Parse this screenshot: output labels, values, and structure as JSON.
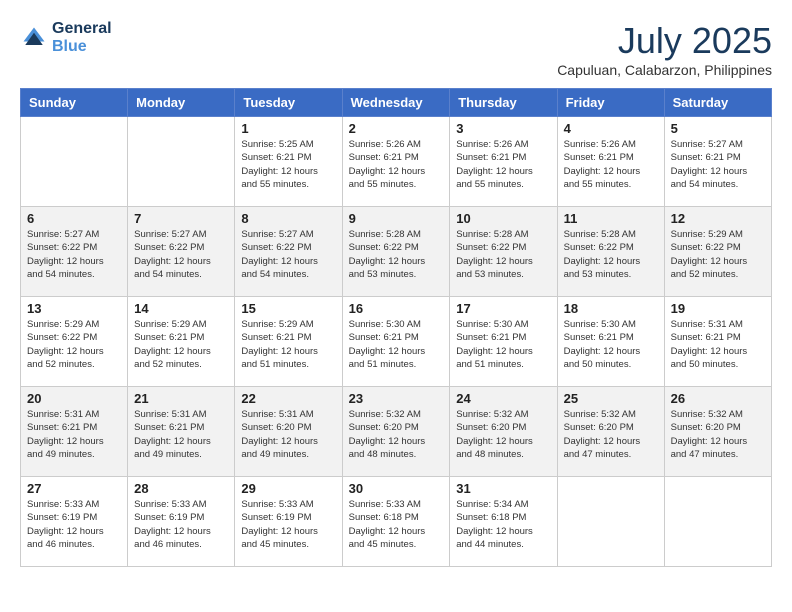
{
  "header": {
    "logo_line1": "General",
    "logo_line2": "Blue",
    "month_title": "July 2025",
    "subtitle": "Capuluan, Calabarzon, Philippines"
  },
  "weekdays": [
    "Sunday",
    "Monday",
    "Tuesday",
    "Wednesday",
    "Thursday",
    "Friday",
    "Saturday"
  ],
  "weeks": [
    [
      {
        "day": "",
        "info": ""
      },
      {
        "day": "",
        "info": ""
      },
      {
        "day": "1",
        "info": "Sunrise: 5:25 AM\nSunset: 6:21 PM\nDaylight: 12 hours and 55 minutes."
      },
      {
        "day": "2",
        "info": "Sunrise: 5:26 AM\nSunset: 6:21 PM\nDaylight: 12 hours and 55 minutes."
      },
      {
        "day": "3",
        "info": "Sunrise: 5:26 AM\nSunset: 6:21 PM\nDaylight: 12 hours and 55 minutes."
      },
      {
        "day": "4",
        "info": "Sunrise: 5:26 AM\nSunset: 6:21 PM\nDaylight: 12 hours and 55 minutes."
      },
      {
        "day": "5",
        "info": "Sunrise: 5:27 AM\nSunset: 6:21 PM\nDaylight: 12 hours and 54 minutes."
      }
    ],
    [
      {
        "day": "6",
        "info": "Sunrise: 5:27 AM\nSunset: 6:22 PM\nDaylight: 12 hours and 54 minutes."
      },
      {
        "day": "7",
        "info": "Sunrise: 5:27 AM\nSunset: 6:22 PM\nDaylight: 12 hours and 54 minutes."
      },
      {
        "day": "8",
        "info": "Sunrise: 5:27 AM\nSunset: 6:22 PM\nDaylight: 12 hours and 54 minutes."
      },
      {
        "day": "9",
        "info": "Sunrise: 5:28 AM\nSunset: 6:22 PM\nDaylight: 12 hours and 53 minutes."
      },
      {
        "day": "10",
        "info": "Sunrise: 5:28 AM\nSunset: 6:22 PM\nDaylight: 12 hours and 53 minutes."
      },
      {
        "day": "11",
        "info": "Sunrise: 5:28 AM\nSunset: 6:22 PM\nDaylight: 12 hours and 53 minutes."
      },
      {
        "day": "12",
        "info": "Sunrise: 5:29 AM\nSunset: 6:22 PM\nDaylight: 12 hours and 52 minutes."
      }
    ],
    [
      {
        "day": "13",
        "info": "Sunrise: 5:29 AM\nSunset: 6:22 PM\nDaylight: 12 hours and 52 minutes."
      },
      {
        "day": "14",
        "info": "Sunrise: 5:29 AM\nSunset: 6:21 PM\nDaylight: 12 hours and 52 minutes."
      },
      {
        "day": "15",
        "info": "Sunrise: 5:29 AM\nSunset: 6:21 PM\nDaylight: 12 hours and 51 minutes."
      },
      {
        "day": "16",
        "info": "Sunrise: 5:30 AM\nSunset: 6:21 PM\nDaylight: 12 hours and 51 minutes."
      },
      {
        "day": "17",
        "info": "Sunrise: 5:30 AM\nSunset: 6:21 PM\nDaylight: 12 hours and 51 minutes."
      },
      {
        "day": "18",
        "info": "Sunrise: 5:30 AM\nSunset: 6:21 PM\nDaylight: 12 hours and 50 minutes."
      },
      {
        "day": "19",
        "info": "Sunrise: 5:31 AM\nSunset: 6:21 PM\nDaylight: 12 hours and 50 minutes."
      }
    ],
    [
      {
        "day": "20",
        "info": "Sunrise: 5:31 AM\nSunset: 6:21 PM\nDaylight: 12 hours and 49 minutes."
      },
      {
        "day": "21",
        "info": "Sunrise: 5:31 AM\nSunset: 6:21 PM\nDaylight: 12 hours and 49 minutes."
      },
      {
        "day": "22",
        "info": "Sunrise: 5:31 AM\nSunset: 6:20 PM\nDaylight: 12 hours and 49 minutes."
      },
      {
        "day": "23",
        "info": "Sunrise: 5:32 AM\nSunset: 6:20 PM\nDaylight: 12 hours and 48 minutes."
      },
      {
        "day": "24",
        "info": "Sunrise: 5:32 AM\nSunset: 6:20 PM\nDaylight: 12 hours and 48 minutes."
      },
      {
        "day": "25",
        "info": "Sunrise: 5:32 AM\nSunset: 6:20 PM\nDaylight: 12 hours and 47 minutes."
      },
      {
        "day": "26",
        "info": "Sunrise: 5:32 AM\nSunset: 6:20 PM\nDaylight: 12 hours and 47 minutes."
      }
    ],
    [
      {
        "day": "27",
        "info": "Sunrise: 5:33 AM\nSunset: 6:19 PM\nDaylight: 12 hours and 46 minutes."
      },
      {
        "day": "28",
        "info": "Sunrise: 5:33 AM\nSunset: 6:19 PM\nDaylight: 12 hours and 46 minutes."
      },
      {
        "day": "29",
        "info": "Sunrise: 5:33 AM\nSunset: 6:19 PM\nDaylight: 12 hours and 45 minutes."
      },
      {
        "day": "30",
        "info": "Sunrise: 5:33 AM\nSunset: 6:18 PM\nDaylight: 12 hours and 45 minutes."
      },
      {
        "day": "31",
        "info": "Sunrise: 5:34 AM\nSunset: 6:18 PM\nDaylight: 12 hours and 44 minutes."
      },
      {
        "day": "",
        "info": ""
      },
      {
        "day": "",
        "info": ""
      }
    ]
  ]
}
